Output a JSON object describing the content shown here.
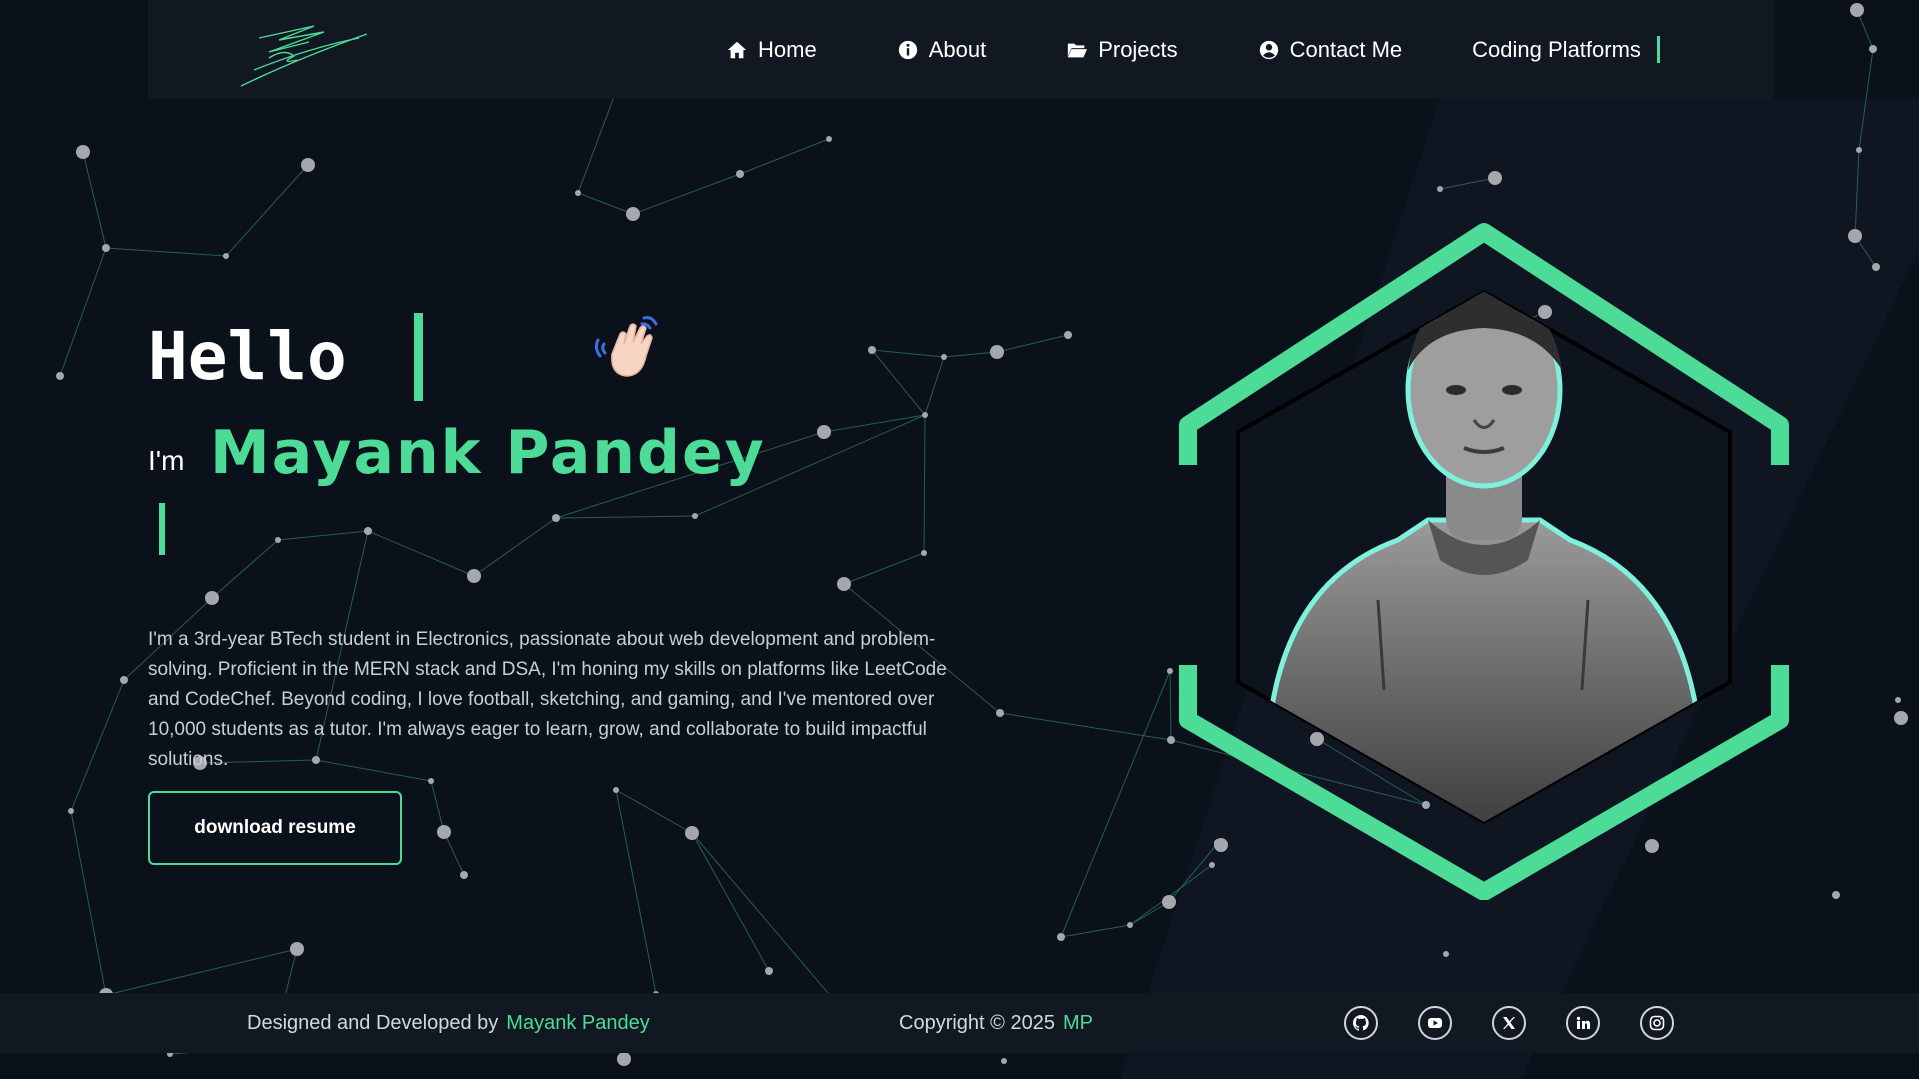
{
  "nav": {
    "items": [
      {
        "label": "Home",
        "icon": "home-icon"
      },
      {
        "label": "About",
        "icon": "info-icon"
      },
      {
        "label": "Projects",
        "icon": "folder-icon"
      },
      {
        "label": "Contact Me",
        "icon": "user-circle-icon"
      }
    ],
    "coding_platforms": "Coding Platforms"
  },
  "hero": {
    "greeting": "Hello",
    "im": "I'm",
    "name": "Mayank Pandey",
    "bio": "I'm a 3rd-year BTech student in Electronics, passionate about web development and problem-solving. Proficient in the MERN stack and DSA, I'm honing my skills on platforms like LeetCode and CodeChef. Beyond coding, I love football, sketching, and gaming, and I've mentored over 10,000 students as a tutor. I'm always eager to learn, grow, and collaborate to build impactful solutions.",
    "button": "download resume"
  },
  "footer": {
    "credit_prefix": "Designed and Developed by",
    "credit_name": "Mayank Pandey",
    "copyright_prefix": "Copyright © 2025",
    "copyright_initials": "MP",
    "socials": [
      "github-icon",
      "youtube-icon",
      "x-icon",
      "linkedin-icon",
      "instagram-icon"
    ]
  },
  "colors": {
    "accent": "#4ddc97",
    "background": "#0b111a",
    "header": "#111822"
  }
}
